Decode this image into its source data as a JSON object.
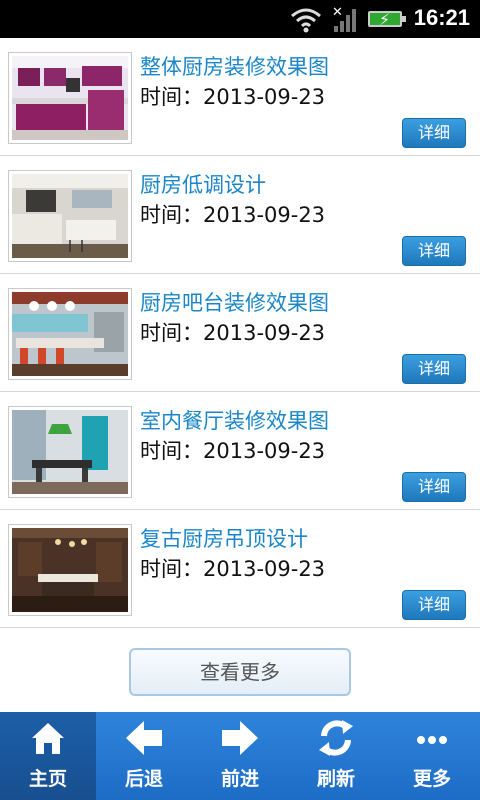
{
  "status_bar": {
    "time": "16:21"
  },
  "items": [
    {
      "title": "整体厨房装修效果图",
      "date": "时间：2013-09-23",
      "button": "详细",
      "thumb": "purple-kitchen"
    },
    {
      "title": "厨房低调设计",
      "date": "时间：2013-09-23",
      "button": "详细",
      "thumb": "white-kitchen"
    },
    {
      "title": "厨房吧台装修效果图",
      "date": "时间：2013-09-23",
      "button": "详细",
      "thumb": "bar-kitchen"
    },
    {
      "title": "室内餐厅装修效果图",
      "date": "时间：2013-09-23",
      "button": "详细",
      "thumb": "dining-room"
    },
    {
      "title": "复古厨房吊顶设计",
      "date": "时间：2013-09-23",
      "button": "详细",
      "thumb": "wood-kitchen"
    }
  ],
  "more_button": "查看更多",
  "nav": [
    {
      "label": "主页",
      "icon": "home-icon"
    },
    {
      "label": "后退",
      "icon": "back-arrow-icon"
    },
    {
      "label": "前进",
      "icon": "forward-arrow-icon"
    },
    {
      "label": "刷新",
      "icon": "refresh-icon"
    },
    {
      "label": "更多",
      "icon": "more-dots-icon"
    }
  ],
  "colors": {
    "title": "#1a86c8",
    "nav": "#2f84da",
    "nav_active": "#1d5fa8",
    "button": "#2a8ad0"
  }
}
